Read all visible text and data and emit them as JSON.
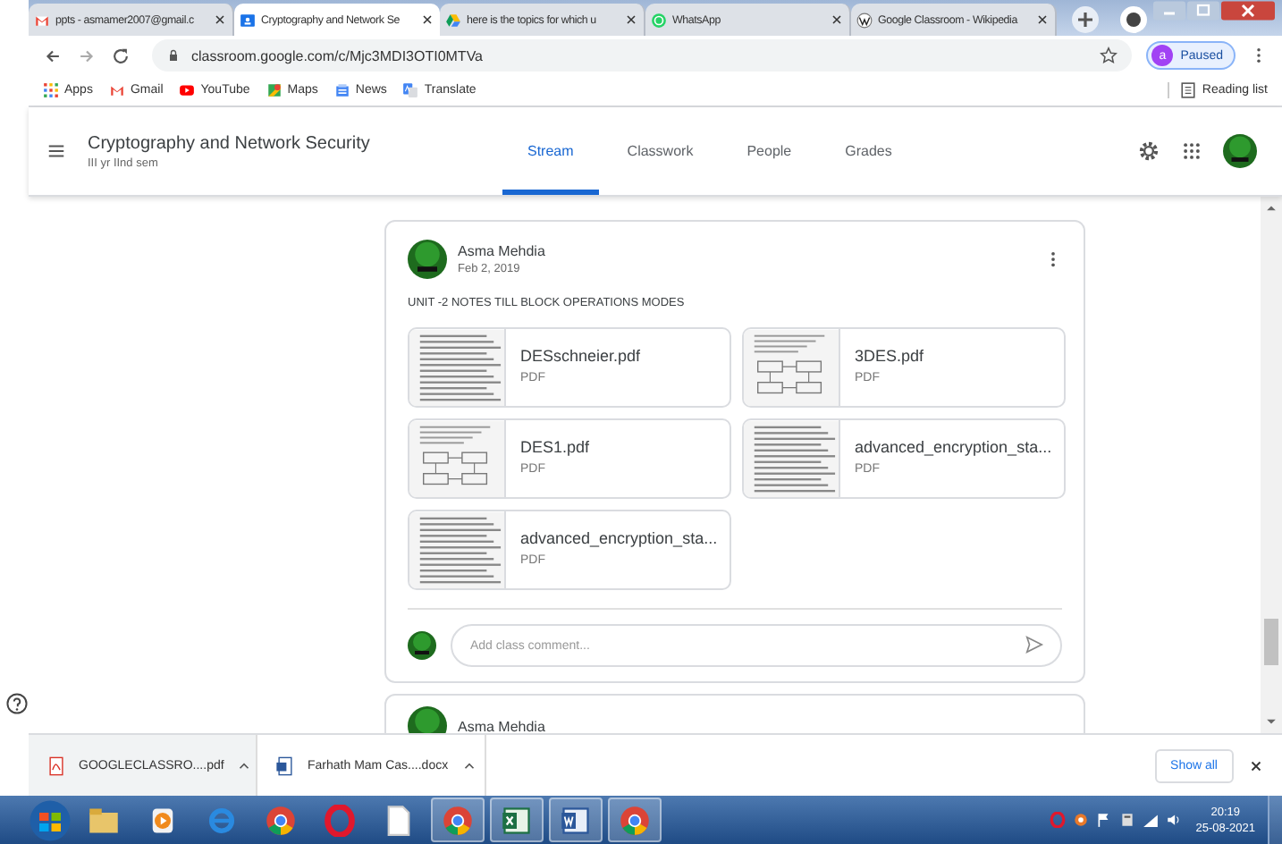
{
  "browser_tabs": [
    {
      "title": "ppts - asmamer2007@gmail.c",
      "selected": false
    },
    {
      "title": "Cryptography and Network Se",
      "selected": true
    },
    {
      "title": "here is the topics for which u",
      "selected": false
    },
    {
      "title": "WhatsApp",
      "selected": false
    },
    {
      "title": "Google Classroom - Wikipedia",
      "selected": false
    }
  ],
  "address": "classroom.google.com/c/Mjc3MDI3OTI0MTVa",
  "profile": {
    "initial": "a",
    "label": "Paused"
  },
  "bookmarks": [
    {
      "label": "Apps"
    },
    {
      "label": "Gmail"
    },
    {
      "label": "YouTube"
    },
    {
      "label": "Maps"
    },
    {
      "label": "News"
    },
    {
      "label": "Translate"
    }
  ],
  "reading_list": "Reading list",
  "classroom": {
    "title": "Cryptography and Network Security",
    "subtitle": "III yr IInd sem",
    "tabs": [
      {
        "label": "Stream",
        "selected": true
      },
      {
        "label": "Classwork",
        "selected": false
      },
      {
        "label": "People",
        "selected": false
      },
      {
        "label": "Grades",
        "selected": false
      }
    ]
  },
  "post": {
    "author": "Asma Mehdia",
    "date": "Feb 2, 2019",
    "text": "UNIT -2 NOTES TILL BLOCK OPERATIONS MODES",
    "attachments": [
      {
        "name": "DESschneier.pdf",
        "type": "PDF"
      },
      {
        "name": "3DES.pdf",
        "type": "PDF"
      },
      {
        "name": "DES1.pdf",
        "type": "PDF"
      },
      {
        "name": "advanced_encryption_sta...",
        "type": "PDF"
      },
      {
        "name": "advanced_encryption_sta...",
        "type": "PDF"
      }
    ],
    "comment_placeholder": "Add class comment..."
  },
  "next_post": {
    "author": "Asma Mehdia"
  },
  "downloads": [
    {
      "name": "GOOGLECLASSRO....pdf",
      "kind": "pdf",
      "selected": true
    },
    {
      "name": "Farhath Mam Cas....docx",
      "kind": "doc",
      "selected": false
    }
  ],
  "show_all": "Show all",
  "taskbar": {
    "apps": [
      {
        "kind": "folder",
        "open": false
      },
      {
        "kind": "media",
        "open": false
      },
      {
        "kind": "ie",
        "open": false
      },
      {
        "kind": "chrome",
        "open": false
      },
      {
        "kind": "opera",
        "open": false
      },
      {
        "kind": "file",
        "open": false
      },
      {
        "kind": "chrome",
        "open": true
      },
      {
        "kind": "excel",
        "open": true
      },
      {
        "kind": "word",
        "open": true
      },
      {
        "kind": "chrome",
        "open": true
      }
    ],
    "time": "20:19",
    "date": "25-08-2021"
  }
}
